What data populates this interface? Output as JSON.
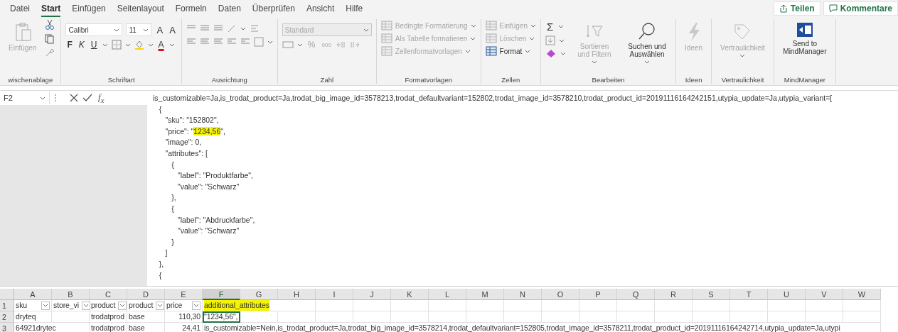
{
  "menu": {
    "tabs": [
      {
        "label": "Datei",
        "selected": false
      },
      {
        "label": "Start",
        "selected": true
      },
      {
        "label": "Einfügen",
        "selected": false
      },
      {
        "label": "Seitenlayout",
        "selected": false
      },
      {
        "label": "Formeln",
        "selected": false
      },
      {
        "label": "Daten",
        "selected": false
      },
      {
        "label": "Überprüfen",
        "selected": false
      },
      {
        "label": "Ansicht",
        "selected": false
      },
      {
        "label": "Hilfe",
        "selected": false
      }
    ],
    "share_button": "Teilen",
    "comments_button": "Kommentare"
  },
  "ribbon": {
    "groups": [
      {
        "kind": "clipboard",
        "label": "wischenablage",
        "items": [
          {
            "text": "Einfügen",
            "disabled": true
          }
        ]
      },
      {
        "kind": "font",
        "label": "Schriftart",
        "font": "Calibri",
        "size": "11",
        "items": [
          {
            "kind": "grow",
            "text": "A"
          },
          {
            "kind": "shrink",
            "text": "A"
          },
          {
            "kind": "bold",
            "text": "F"
          },
          {
            "kind": "italic",
            "text": "K"
          },
          {
            "kind": "underline",
            "text": "U"
          },
          {
            "kind": "color",
            "text": "A"
          }
        ]
      },
      {
        "kind": "alignment",
        "label": "Ausrichtung"
      },
      {
        "kind": "number",
        "label": "Zahl",
        "format": "Standard",
        "items": [
          {
            "text": "%"
          },
          {
            "text": "000"
          }
        ]
      },
      {
        "kind": "styles",
        "label": "Formatvorlagen",
        "items": [
          {
            "text": "Bedingte Formatierung",
            "disabled": true
          },
          {
            "text": "Als Tabelle formatieren",
            "disabled": true
          },
          {
            "text": "Zellenformatvorlagen",
            "disabled": true
          }
        ]
      },
      {
        "kind": "cells",
        "label": "Zellen",
        "items": [
          {
            "text": "Einfügen",
            "disabled": true
          },
          {
            "text": "Löschen",
            "disabled": true
          },
          {
            "text": "Format",
            "disabled": false
          }
        ]
      },
      {
        "kind": "editing",
        "label": "Bearbeiten",
        "items": [
          {
            "text": "Σ",
            "disabled": false
          },
          {
            "text": "Sortieren und Filtern",
            "disabled": true
          },
          {
            "text": "Suchen und Auswählen",
            "disabled": false
          }
        ]
      },
      {
        "kind": "ideas",
        "label": "Ideen",
        "items": [
          {
            "text": "Ideen",
            "disabled": true
          }
        ]
      },
      {
        "kind": "sensitivity",
        "label": "Vertraulichkeit",
        "items": [
          {
            "text": "Vertraulichkeit",
            "disabled": true
          }
        ]
      },
      {
        "kind": "mindmanager",
        "label": "MindManager",
        "items": [
          {
            "text": "Send to MindManager",
            "disabled": false
          }
        ]
      }
    ]
  },
  "formula_bar": {
    "name_box": "F2",
    "function_label": "f$_{x}$",
    "lines": [
      {
        "text": "is_customizable=Ja,is_trodat_product=Ja,trodat_big_image_id=3578213,trodat_defaultvariant=152802,trodat_image_id=3578210,trodat_product_id=20191116164242151,utypia_update=Ja,utypia_variant=["
      },
      {
        "text": "   {"
      },
      {
        "text": "      \"sku\": \"152802\","
      },
      {
        "parts": [
          {
            "text": "      \"price\": \"",
            "highlight": false
          },
          {
            "text": "1234,56",
            "highlight": true
          },
          {
            "text": "\",",
            "highlight": false
          }
        ]
      },
      {
        "text": "      \"image\": 0,"
      },
      {
        "text": "      \"attributes\": ["
      },
      {
        "text": "         {"
      },
      {
        "text": "            \"label\": \"Produktfarbe\","
      },
      {
        "text": "            \"value\": \"Schwarz\""
      },
      {
        "text": "         },"
      },
      {
        "text": "         {"
      },
      {
        "text": "            \"label\": \"Abdruckfarbe\","
      },
      {
        "text": "            \"value\": \"Schwarz\""
      },
      {
        "text": "         }"
      },
      {
        "text": "      ]"
      },
      {
        "text": "   },"
      },
      {
        "text": "   {"
      }
    ]
  },
  "sheet": {
    "columns": [
      {
        "label": "A",
        "selected": false
      },
      {
        "label": "B",
        "selected": false
      },
      {
        "label": "C",
        "selected": false
      },
      {
        "label": "D",
        "selected": false
      },
      {
        "label": "E",
        "selected": false
      },
      {
        "label": "F",
        "selected": true
      },
      {
        "label": "G",
        "selected": false
      },
      {
        "label": "H",
        "selected": false
      },
      {
        "label": "I",
        "selected": false
      },
      {
        "label": "J",
        "selected": false
      },
      {
        "label": "K",
        "selected": false
      },
      {
        "label": "L",
        "selected": false
      },
      {
        "label": "M",
        "selected": false
      },
      {
        "label": "N",
        "selected": false
      },
      {
        "label": "O",
        "selected": false
      },
      {
        "label": "P",
        "selected": false
      },
      {
        "label": "Q",
        "selected": false
      },
      {
        "label": "R",
        "selected": false
      },
      {
        "label": "S",
        "selected": false
      },
      {
        "label": "T",
        "selected": false
      },
      {
        "label": "U",
        "selected": false
      },
      {
        "label": "V",
        "selected": false
      },
      {
        "label": "W",
        "selected": false
      }
    ],
    "rows": [
      {
        "number": "1",
        "cells": [
          {
            "text": "sku",
            "kind": "text",
            "filter": true
          },
          {
            "text": "store_vi",
            "kind": "text",
            "filter": true
          },
          {
            "text": "product",
            "kind": "text",
            "filter": true
          },
          {
            "text": "product",
            "kind": "text",
            "filter": true
          },
          {
            "text": "price",
            "kind": "text",
            "filter": true
          },
          {
            "text": "additional_attributes",
            "kind": "text",
            "highlight": true
          }
        ]
      },
      {
        "number": "2",
        "cells": [
          {
            "text": "dryteq",
            "kind": "text"
          },
          {},
          {
            "text": "trodatprod",
            "kind": "text"
          },
          {
            "text": "base",
            "kind": "text"
          },
          {
            "text": "110,30",
            "kind": "number"
          },
          {
            "text": "\"1234,56\",",
            "kind": "text",
            "selected": true
          }
        ]
      },
      {
        "number": "3",
        "cells": [
          {
            "text": "64921drytec",
            "kind": "text"
          },
          {},
          {
            "text": "trodatprod",
            "kind": "text"
          },
          {
            "text": "base",
            "kind": "text"
          },
          {
            "text": "24,41",
            "kind": "number"
          },
          {
            "text": "is_customizable=Nein,is_trodat_product=Ja,trodat_big_image_id=3578214,trodat_defaultvariant=152805,trodat_image_id=3578211,trodat_product_id=20191116164242714,utypia_update=Ja,utypi",
            "kind": "text"
          }
        ]
      }
    ]
  }
}
